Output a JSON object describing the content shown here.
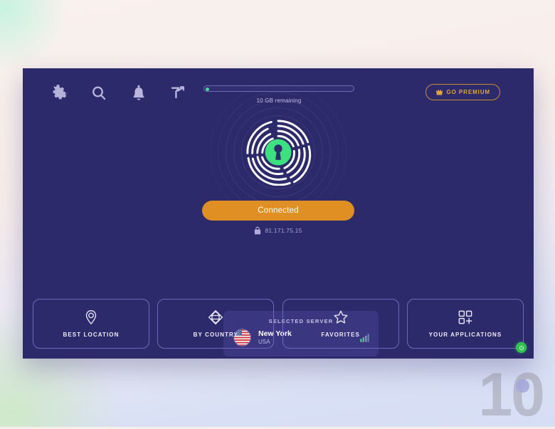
{
  "window": {
    "panel_color": "#2d2a6b",
    "card_color": "#3b3680"
  },
  "toolbar": {
    "icons": [
      {
        "name": "gear-icon",
        "label": "Settings"
      },
      {
        "name": "search-icon",
        "label": "Search"
      },
      {
        "name": "bell-icon",
        "label": "Notifications"
      },
      {
        "name": "filter-icon",
        "label": "Filter"
      }
    ],
    "data_meter": {
      "label": "10 GB remaining",
      "percent": 0,
      "accent": "#3ce07f"
    },
    "premium": {
      "label": "GO PREMIUM",
      "icon": "crown-icon",
      "accent": "#e0a33e"
    }
  },
  "hero": {
    "logo_icon": "fingerprint-lock-icon",
    "logo_center_color": "#3ce07f",
    "status_button": {
      "label": "Connected",
      "color": "#e08f22"
    },
    "ip_address": "81.171.75.15",
    "ip_icon": "lock-icon"
  },
  "server": {
    "title": "SELECTED SERVER",
    "city": "New York",
    "country": "USA",
    "flag_icon": "us-flag-icon",
    "signal_icon": "signal-bars-icon",
    "signal_color": "#4cc9a0"
  },
  "bottom_nav": [
    {
      "label": "BEST LOCATION",
      "icon": "map-pin-icon"
    },
    {
      "label": "BY COUNTRY",
      "icon": "globe-diamond-icon"
    },
    {
      "label": "FAVORITES",
      "icon": "star-icon"
    },
    {
      "label": "YOUR APPLICATIONS",
      "icon": "apps-grid-plus-icon"
    }
  ],
  "corner_badge": {
    "icon": "power-icon",
    "color": "#2fc04f"
  },
  "watermark": {
    "text": "10"
  }
}
